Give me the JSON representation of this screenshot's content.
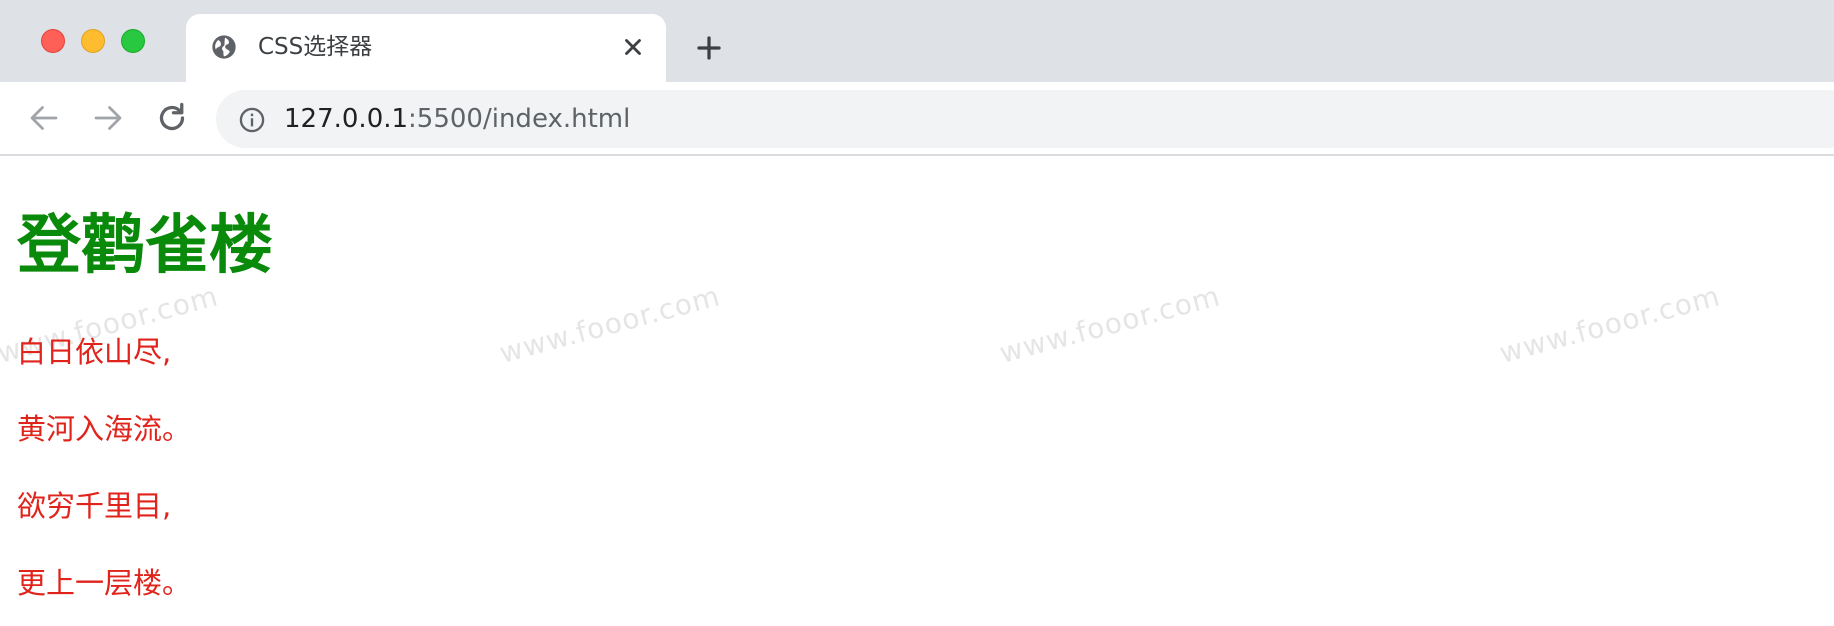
{
  "window": {
    "controls": {
      "close_color": "#fe5f57",
      "minimize_color": "#febc2e",
      "maximize_color": "#28c840"
    }
  },
  "tabs": [
    {
      "title": "CSS选择器",
      "icon": "globe-icon",
      "active": true
    }
  ],
  "toolbar": {
    "back_icon": "arrow-left-icon",
    "forward_icon": "arrow-right-icon",
    "reload_icon": "reload-icon",
    "new_tab_icon": "plus-icon"
  },
  "address_bar": {
    "info_icon": "info-icon",
    "host": "127.0.0.1",
    "path": ":5500/index.html"
  },
  "page": {
    "heading": "登鹳雀楼",
    "heading_color": "#0a8a0a",
    "line_color": "#e0231b",
    "lines": [
      "白日依山尽,",
      "黄河入海流。",
      "欲穷千里目,",
      "更上一层楼。"
    ],
    "watermark": "www.fooor.com"
  }
}
